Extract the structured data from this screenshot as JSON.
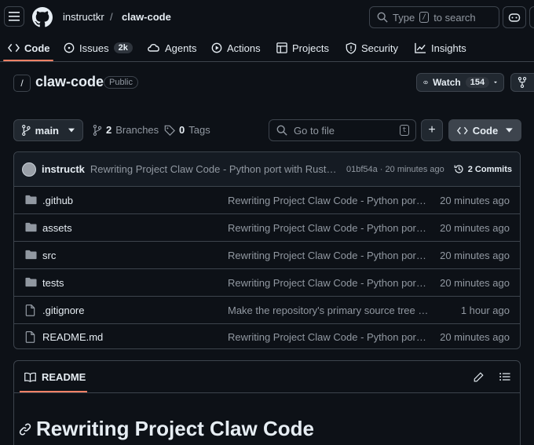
{
  "header": {
    "owner": "instructkr",
    "separator": "/",
    "repo": "claw-code",
    "search_prefix": "Type",
    "search_key": "/",
    "search_suffix": "to search"
  },
  "tabs": [
    {
      "label": "Code",
      "icon": "code-icon",
      "active": true
    },
    {
      "label": "Issues",
      "icon": "issue-icon",
      "count": "2k"
    },
    {
      "label": "Agents",
      "icon": "agents-icon"
    },
    {
      "label": "Actions",
      "icon": "play-icon"
    },
    {
      "label": "Projects",
      "icon": "table-icon"
    },
    {
      "label": "Security",
      "icon": "shield-icon"
    },
    {
      "label": "Insights",
      "icon": "graph-icon"
    }
  ],
  "repo": {
    "icon_glyph": "/",
    "name": "claw-code",
    "visibility": "Public",
    "watch_label": "Watch",
    "watch_count": "154"
  },
  "toolbar": {
    "branch": "main",
    "branches_count": "2",
    "branches_label": "Branches",
    "tags_count": "0",
    "tags_label": "Tags",
    "goto_placeholder": "Go to file",
    "goto_key": "t",
    "plus_label": "+",
    "code_label": "Code"
  },
  "latest_commit": {
    "author": "instructk",
    "message": "Rewriting Project Claw Code - Python port with Rust on t...",
    "sha_time": "01bf54a · 20 minutes ago",
    "commits_label": "2 Commits"
  },
  "files": [
    {
      "name": ".github",
      "type": "dir",
      "message": "Rewriting Project Claw Code - Python port wi...",
      "time": "20 minutes ago"
    },
    {
      "name": "assets",
      "type": "dir",
      "message": "Rewriting Project Claw Code - Python port wi...",
      "time": "20 minutes ago"
    },
    {
      "name": "src",
      "type": "dir",
      "message": "Rewriting Project Claw Code - Python port wi...",
      "time": "20 minutes ago"
    },
    {
      "name": "tests",
      "type": "dir",
      "message": "Rewriting Project Claw Code - Python port wi...",
      "time": "20 minutes ago"
    },
    {
      "name": ".gitignore",
      "type": "file",
      "message": "Make the repository's primary source tree ge...",
      "time": "1 hour ago"
    },
    {
      "name": "README.md",
      "type": "file",
      "message": "Rewriting Project Claw Code - Python port wi...",
      "time": "20 minutes ago"
    }
  ],
  "readme": {
    "tab_label": "README",
    "heading": "Rewriting Project Claw Code"
  },
  "colors": {
    "background": "#0d1117",
    "border": "#3d444d",
    "text": "#e6edf3",
    "muted": "#9198a1",
    "accent": "#f78166"
  }
}
